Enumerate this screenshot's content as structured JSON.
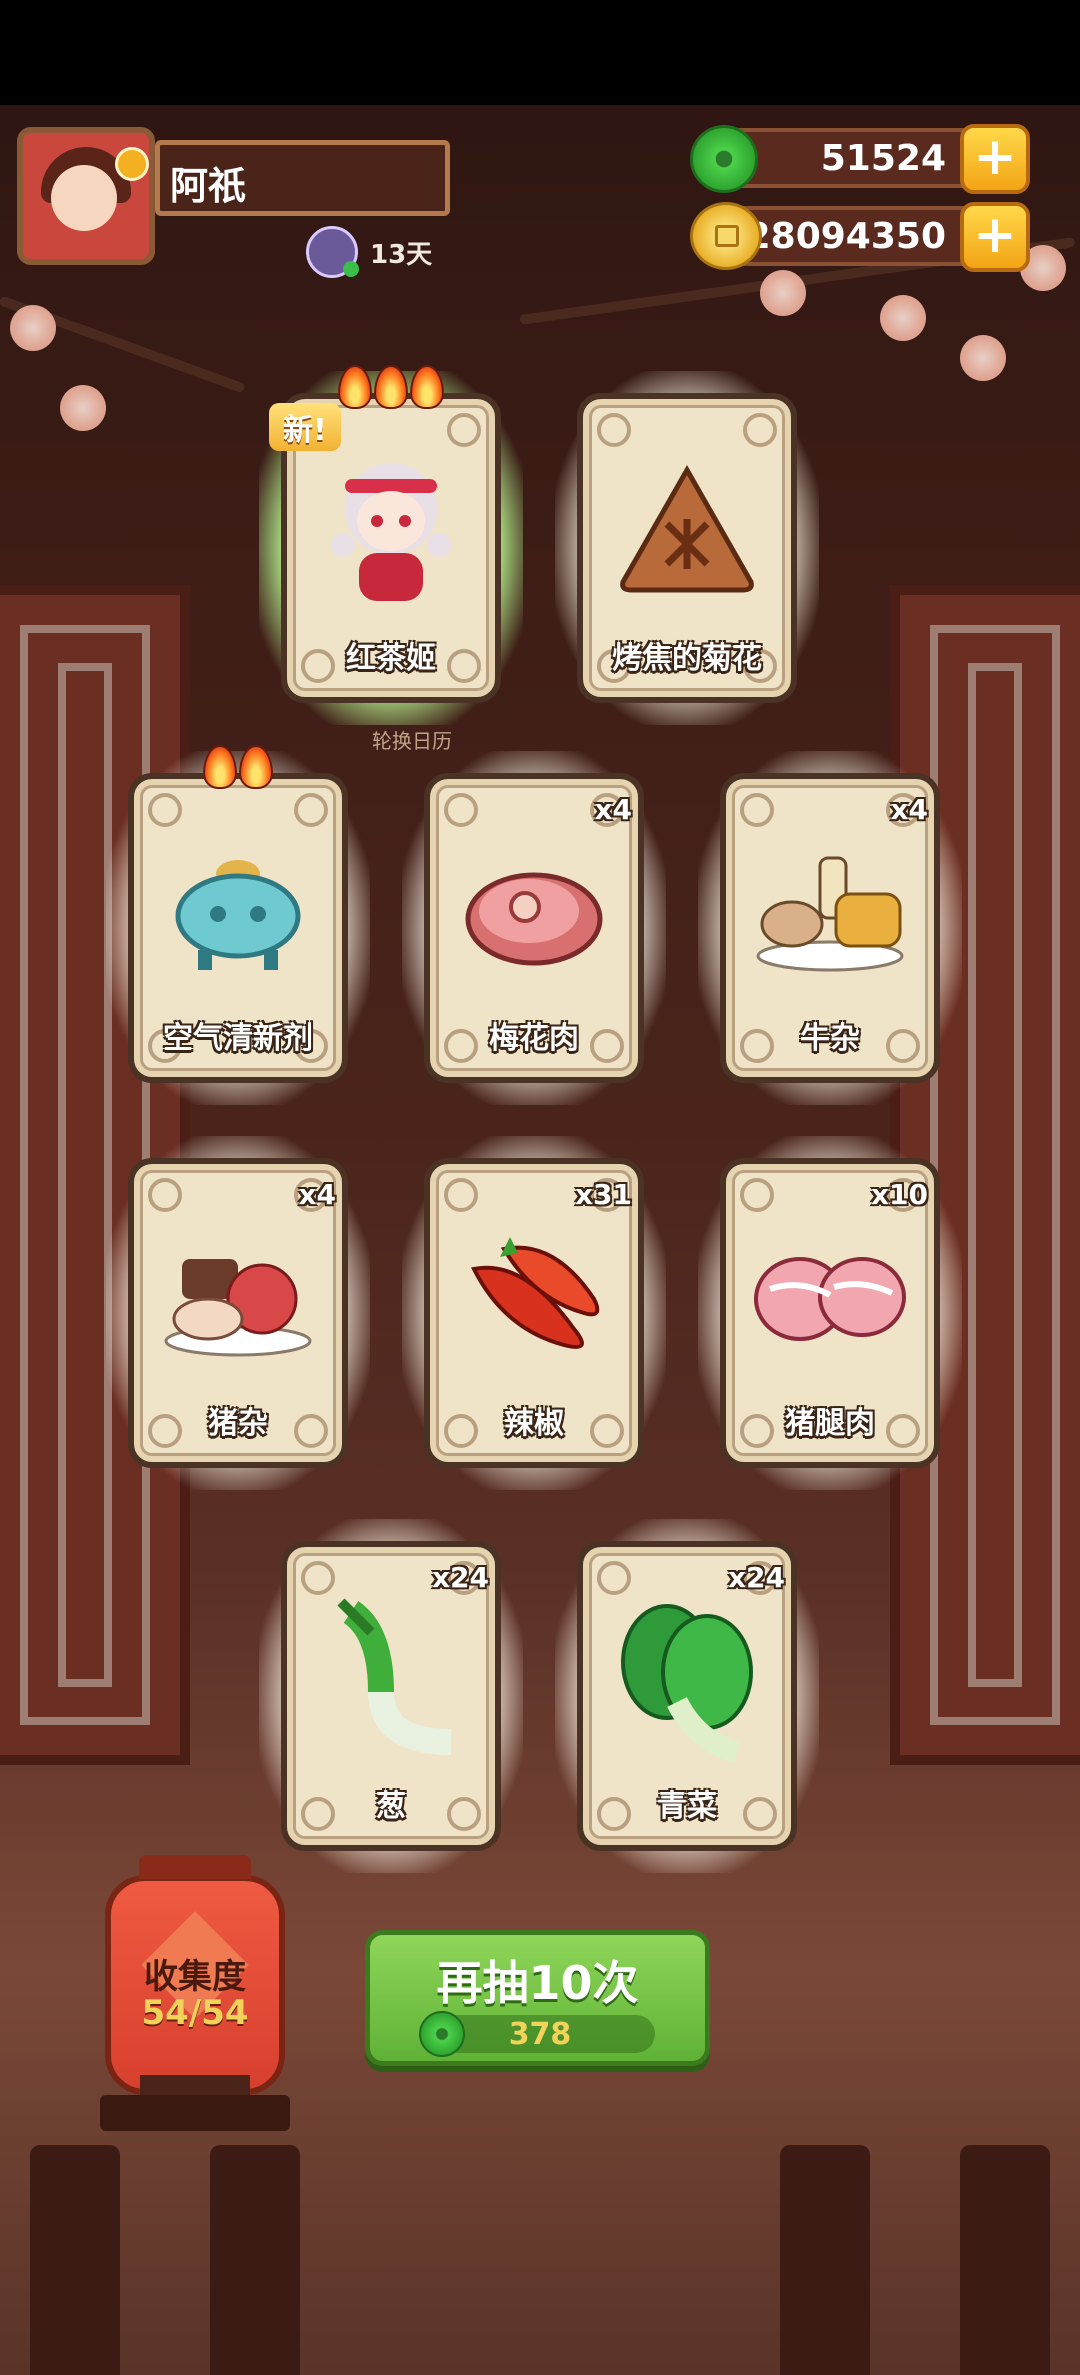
{
  "player": {
    "name": "阿祇",
    "days": "13天"
  },
  "currency": {
    "jade": "51524",
    "gold": "28094350",
    "plus": "+"
  },
  "banner": {
    "new_tag": "新!",
    "caption": "轮换日历"
  },
  "cards": [
    {
      "label": "红茶姬",
      "count": "",
      "icon": "character-icon"
    },
    {
      "label": "烤焦的菊花",
      "count": "",
      "icon": "burnt-bun-icon"
    },
    {
      "label": "空气清新剂",
      "count": "",
      "icon": "incense-burner-icon"
    },
    {
      "label": "梅花肉",
      "count": "x4",
      "icon": "pork-shoulder-icon"
    },
    {
      "label": "牛杂",
      "count": "x4",
      "icon": "beef-offal-icon"
    },
    {
      "label": "猪杂",
      "count": "x4",
      "icon": "pork-offal-icon"
    },
    {
      "label": "辣椒",
      "count": "x31",
      "icon": "chili-icon"
    },
    {
      "label": "猪腿肉",
      "count": "x10",
      "icon": "pork-leg-icon"
    },
    {
      "label": "葱",
      "count": "x24",
      "icon": "scallion-icon"
    },
    {
      "label": "青菜",
      "count": "x24",
      "icon": "bok-choy-icon"
    }
  ],
  "collection": {
    "title": "收集度",
    "progress": "54/54"
  },
  "draw_button": {
    "label": "再抽10次",
    "cost": "378"
  }
}
